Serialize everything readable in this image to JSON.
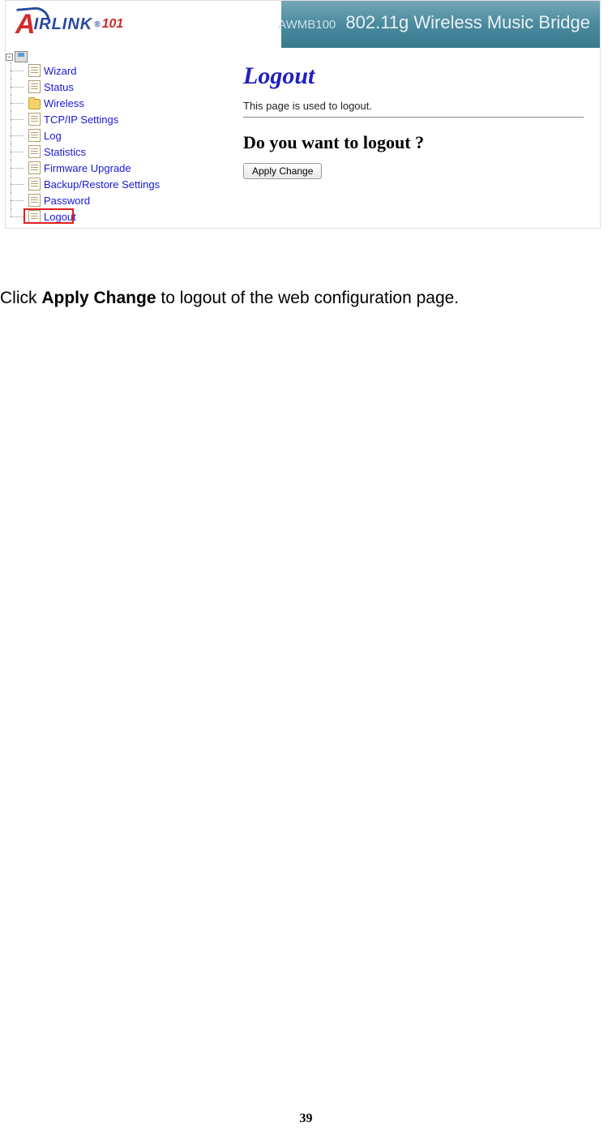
{
  "header": {
    "logo_brand_a": "A",
    "logo_brand_rest": "IRLINK",
    "logo_reg": "®",
    "logo_num": "101",
    "model": "AWMB100",
    "product": "802.11g Wireless Music Bridge"
  },
  "sidebar": {
    "items": [
      {
        "label": "Wizard",
        "type": "file"
      },
      {
        "label": "Status",
        "type": "file"
      },
      {
        "label": "Wireless",
        "type": "folder"
      },
      {
        "label": "TCP/IP Settings",
        "type": "file"
      },
      {
        "label": "Log",
        "type": "file"
      },
      {
        "label": "Statistics",
        "type": "file"
      },
      {
        "label": "Firmware Upgrade",
        "type": "file"
      },
      {
        "label": "Backup/Restore Settings",
        "type": "file"
      },
      {
        "label": "Password",
        "type": "file"
      },
      {
        "label": "Logout",
        "type": "file"
      }
    ]
  },
  "content": {
    "title": "Logout",
    "description": "This page is used to logout.",
    "question": "Do you want to logout ?",
    "button_label": "Apply Change"
  },
  "instruction": {
    "prefix": "Click ",
    "strong": "Apply Change",
    "suffix": " to logout of the web configuration page."
  },
  "page_number": "39"
}
